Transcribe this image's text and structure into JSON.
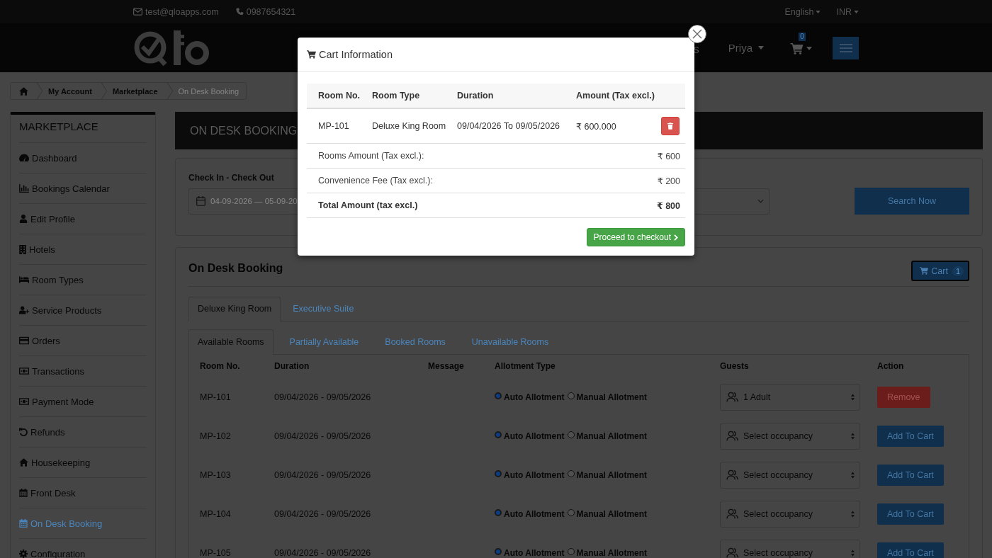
{
  "topbar": {
    "email": "test@qloapps.com",
    "phone": "0987654321",
    "language": "English",
    "currency": "INR"
  },
  "header": {
    "nav_link": "s",
    "user": "Priya",
    "cart_count": "0"
  },
  "breadcrumb": [
    {
      "label": "My Account",
      "current": false
    },
    {
      "label": "Marketplace",
      "current": false
    },
    {
      "label": "On Desk Booking",
      "current": true
    }
  ],
  "sidebar": {
    "title": "MARKETPLACE",
    "items": [
      {
        "label": "Dashboard",
        "selected": false
      },
      {
        "label": "Bookings Calendar",
        "selected": false
      },
      {
        "label": "Edit Profile",
        "selected": false
      },
      {
        "label": "Hotels",
        "selected": false
      },
      {
        "label": "Room Types",
        "selected": false
      },
      {
        "label": "Service Products",
        "selected": false
      },
      {
        "label": "Orders",
        "selected": false
      },
      {
        "label": "Transactions",
        "selected": false
      },
      {
        "label": "Payment Mode",
        "selected": false
      },
      {
        "label": "Refunds",
        "selected": false
      },
      {
        "label": "Housekeeping",
        "selected": false
      },
      {
        "label": "Front Desk",
        "selected": false
      },
      {
        "label": "On Desk Booking",
        "selected": true
      },
      {
        "label": "Configuration",
        "selected": false
      }
    ]
  },
  "page_title": "ON DESK BOOKING",
  "search": {
    "label": "Check In - Check Out",
    "dates": "04-09-2026 — 05-09-20",
    "button": "Search Now"
  },
  "booking": {
    "title": "On Desk Booking",
    "cart_button": {
      "label": "Cart",
      "count": "1"
    },
    "room_tabs": [
      {
        "label": "Deluxe King Room",
        "selected": true
      },
      {
        "label": "Executive Suite",
        "selected": false
      }
    ],
    "status_tabs": [
      {
        "label": "Available Rooms",
        "selected": true
      },
      {
        "label": "Partially Available",
        "selected": false
      },
      {
        "label": "Booked Rooms",
        "selected": false
      },
      {
        "label": "Unavailable Rooms",
        "selected": false
      }
    ],
    "table": {
      "columns": [
        "Room No.",
        "Duration",
        "Message",
        "Allotment Type",
        "Guests",
        "Action"
      ],
      "rows": [
        {
          "room": "MP-101",
          "duration": "09/04/2026 - 09/05/2026",
          "allotment": [
            {
              "label": "Auto Allotment",
              "selected": true
            },
            {
              "label": "Manual Allotment",
              "selected": false
            }
          ],
          "guests": "1 Adult",
          "action": {
            "kind": "remove",
            "label": "Remove"
          }
        },
        {
          "room": "MP-102",
          "duration": "09/04/2026 - 09/05/2026",
          "allotment": [
            {
              "label": "Auto Allotment",
              "selected": true
            },
            {
              "label": "Manual Allotment",
              "selected": false
            }
          ],
          "guests": "Select occupancy",
          "action": {
            "kind": "add",
            "label": "Add To Cart"
          }
        },
        {
          "room": "MP-103",
          "duration": "09/04/2026 - 09/05/2026",
          "allotment": [
            {
              "label": "Auto Allotment",
              "selected": true
            },
            {
              "label": "Manual Allotment",
              "selected": false
            }
          ],
          "guests": "Select occupancy",
          "action": {
            "kind": "add",
            "label": "Add To Cart"
          }
        },
        {
          "room": "MP-104",
          "duration": "09/04/2026 - 09/05/2026",
          "allotment": [
            {
              "label": "Auto Allotment",
              "selected": true
            },
            {
              "label": "Manual Allotment",
              "selected": false
            }
          ],
          "guests": "Select occupancy",
          "action": {
            "kind": "add",
            "label": "Add To Cart"
          }
        },
        {
          "room": "MP-105",
          "duration": "09/04/2026 - 09/05/2026",
          "allotment": [
            {
              "label": "Auto Allotment",
              "selected": true
            },
            {
              "label": "Manual Allotment",
              "selected": false
            }
          ],
          "guests": "Select occupancy",
          "action": {
            "kind": "add",
            "label": "Add To Cart"
          }
        }
      ]
    }
  },
  "modal": {
    "title": "Cart Information",
    "columns": [
      "Room No.",
      "Room Type",
      "Duration",
      "Amount (Tax excl.)"
    ],
    "items": [
      {
        "room": "MP-101",
        "room_type": "Deluxe King Room",
        "duration": "09/04/2026 To 09/05/2026",
        "amount": "₹ 600.000"
      }
    ],
    "summary": [
      {
        "kind": "line",
        "label": "Rooms Amount (Tax excl.):",
        "value": "₹ 600"
      },
      {
        "kind": "line",
        "label": "Convenience Fee (Tax excl.):",
        "value": "₹ 200"
      },
      {
        "kind": "total",
        "label": "Total Amount (tax excl.)",
        "value": "₹ 800"
      }
    ],
    "checkout_button": "Proceed to checkout"
  }
}
